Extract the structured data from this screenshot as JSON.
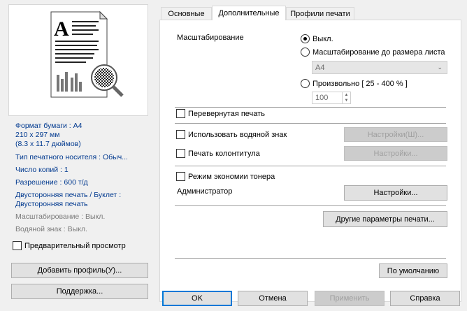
{
  "tabs": [
    {
      "label": "Основные"
    },
    {
      "label": "Дополнительные"
    },
    {
      "label": "Профили печати"
    }
  ],
  "info": {
    "paper_size": "Формат бумаги : A4",
    "paper_dims_mm": "210 x 297 мм",
    "paper_dims_in": "(8.3 x 11.7 дюймов)",
    "media_type": "Тип печатного носителя : Обыч...",
    "copies": "Число копий : 1",
    "resolution": "Разрешение : 600 т/д",
    "duplex_line1": "Двусторонняя печать / Буклет :",
    "duplex_line2": "Двусторонняя печать",
    "scaling": "Масштабирование : Выкл.",
    "watermark": "Водяной знак : Выкл."
  },
  "left": {
    "preview_label": "Предварительный просмотр",
    "add_profile": "Добавить профиль(У)...",
    "support": "Поддержка..."
  },
  "scaling": {
    "label": "Масштабирование",
    "off": "Выкл.",
    "fit": "Масштабирование до размера листа",
    "paper": "A4",
    "free": "Произвольно [ 25 - 400 % ]",
    "free_value": "100"
  },
  "options": {
    "reverse": "Перевернутая печать",
    "watermark": "Использовать водяной знак",
    "watermark_settings": "Настройки(Ш)...",
    "header_footer": "Печать колонтитула",
    "header_footer_settings": "Настройки...",
    "toner_save": "Режим экономии тонера",
    "admin": "Администратор",
    "admin_settings": "Настройки...",
    "other": "Другие параметры печати...",
    "default": "По умолчанию"
  },
  "footer": {
    "ok": "OK",
    "cancel": "Отмена",
    "apply": "Применить",
    "help": "Справка"
  }
}
